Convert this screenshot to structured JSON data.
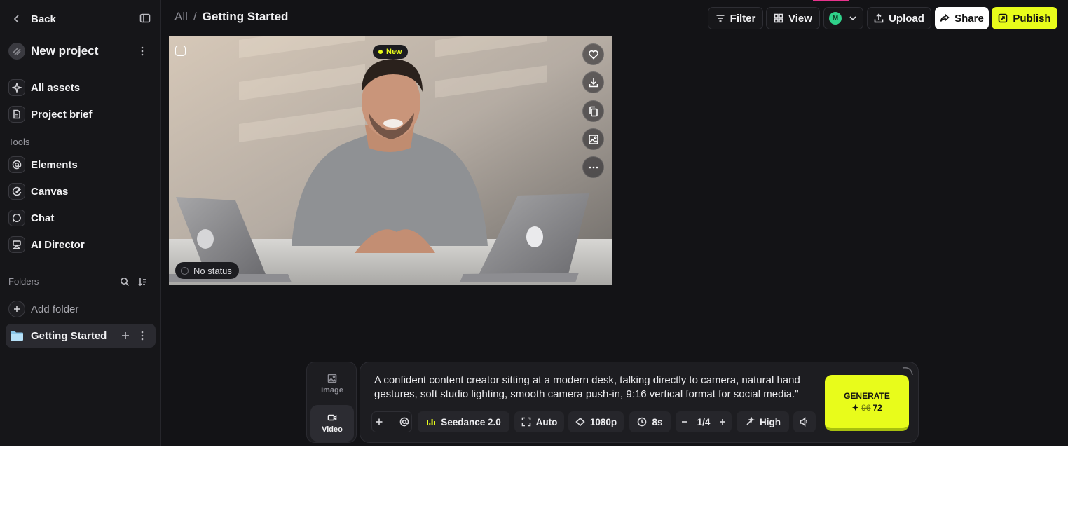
{
  "sidebar": {
    "back_label": "Back",
    "project_name": "New project",
    "nav": [
      {
        "label": "All assets",
        "icon": "sparkle-icon"
      },
      {
        "label": "Project brief",
        "icon": "document-icon"
      }
    ],
    "tools_heading": "Tools",
    "tools": [
      {
        "label": "Elements",
        "icon": "at-icon"
      },
      {
        "label": "Canvas",
        "icon": "canvas-icon"
      },
      {
        "label": "Chat",
        "icon": "chat-bubble-icon"
      },
      {
        "label": "AI Director",
        "icon": "director-icon"
      }
    ],
    "folders_heading": "Folders",
    "add_folder_label": "Add folder",
    "folders": [
      {
        "label": "Getting Started",
        "selected": true
      }
    ]
  },
  "topbar": {
    "breadcrumb_root": "All",
    "breadcrumb_separator": "/",
    "breadcrumb_current": "Getting Started",
    "filter_label": "Filter",
    "view_label": "View",
    "avatar_initial": "M",
    "upload_label": "Upload",
    "share_label": "Share",
    "publish_label": "Publish"
  },
  "asset_card": {
    "badge_label": "New",
    "status_label": "No status",
    "actions": [
      "heart-icon",
      "download-icon",
      "copy-icon",
      "image-icon",
      "more-icon"
    ]
  },
  "composer": {
    "modes": [
      {
        "label": "Image",
        "icon": "image-icon",
        "active": false
      },
      {
        "label": "Video",
        "icon": "video-icon",
        "active": true
      }
    ],
    "prompt": "A confident content creator sitting at a modern desk, talking directly to camera, natural hand gestures, soft studio lighting, smooth camera push-in, 9:16 vertical format for social media.\"",
    "model_label": "Seedance 2.0",
    "aspect_label": "Auto",
    "resolution_label": "1080p",
    "duration_label": "8s",
    "count_label": "1/4",
    "quality_label": "High",
    "generate_label": "GENERATE",
    "credits_old": "96",
    "credits_new": "72"
  },
  "colors": {
    "accent": "#e8fc1b",
    "background": "#131316",
    "sidebar": "#161619",
    "avatar": "#2fd18a"
  }
}
